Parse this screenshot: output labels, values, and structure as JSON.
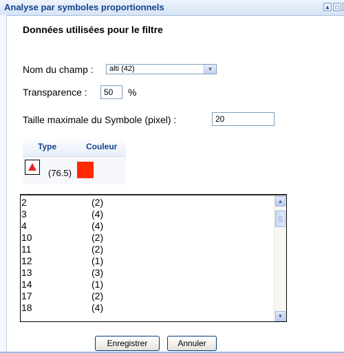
{
  "window": {
    "title": "Analyse par symboles proportionnels"
  },
  "section": {
    "heading": "Données utilisées pour le filtre"
  },
  "form": {
    "field_label": "Nom du champ :",
    "field_value": "alti (42)",
    "transparency_label": "Transparence :",
    "transparency_value": "50",
    "transparency_unit": "%",
    "max_size_label": "Taille maximale du Symbole (pixel) :",
    "max_size_value": "20"
  },
  "legend": {
    "type_header": "Type",
    "color_header": "Couleur",
    "symbol_value": "(76.5)",
    "symbol_icon": "red-triangle-icon",
    "color": "#ff2a00"
  },
  "values_list": [
    {
      "value": "2",
      "count": "(2)"
    },
    {
      "value": "3",
      "count": "(4)"
    },
    {
      "value": "4",
      "count": "(4)"
    },
    {
      "value": "10",
      "count": "(2)"
    },
    {
      "value": "11",
      "count": "(2)"
    },
    {
      "value": "12",
      "count": "(1)"
    },
    {
      "value": "13",
      "count": "(3)"
    },
    {
      "value": "14",
      "count": "(1)"
    },
    {
      "value": "17",
      "count": "(2)"
    },
    {
      "value": "18",
      "count": "(4)"
    }
  ],
  "buttons": {
    "save": "Enregistrer",
    "cancel": "Annuler"
  }
}
